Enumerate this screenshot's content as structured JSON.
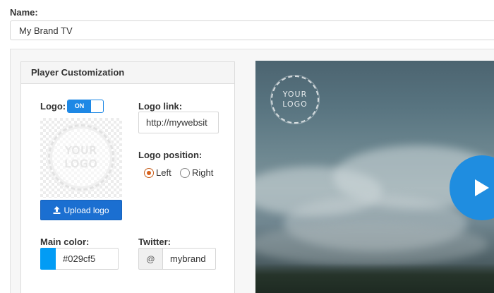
{
  "name_field": {
    "label": "Name:",
    "value": "My Brand TV"
  },
  "panel": {
    "title": "Player Customization"
  },
  "logo": {
    "label": "Logo:",
    "toggle_label": "ON",
    "preview_text_line1": "YOUR",
    "preview_text_line2": "LOGO",
    "upload_label": "Upload logo",
    "upload_icon": "upload-icon"
  },
  "logo_link": {
    "label": "Logo link:",
    "value": "http://mywebsit"
  },
  "logo_position": {
    "label": "Logo position:",
    "options": [
      "Left",
      "Right"
    ],
    "selected": "Left"
  },
  "main_color": {
    "label": "Main color:",
    "value": "#029cf5",
    "swatch_color": "#029cf5"
  },
  "twitter": {
    "label": "Twitter:",
    "prefix": "@",
    "value": "mybrand"
  },
  "video": {
    "watermark_line1": "YOUR",
    "watermark_line2": "LOGO",
    "play_icon": "play-icon",
    "accent_color": "#1f8de0"
  }
}
